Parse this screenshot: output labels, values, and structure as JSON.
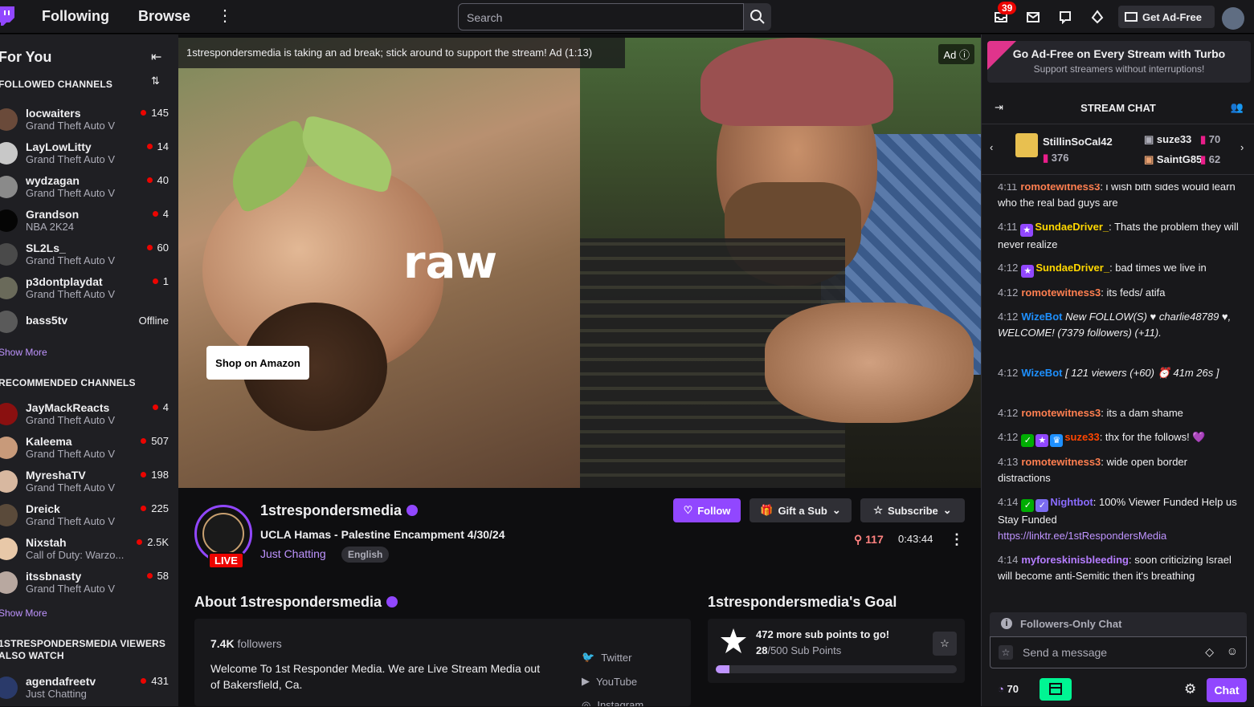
{
  "topbar": {
    "following": "Following",
    "browse": "Browse",
    "search_placeholder": "Search",
    "notif_count": "39",
    "get_ad_free": "Get Ad-Free"
  },
  "sidebar": {
    "title": "For You",
    "followed_header": "Followed Channels",
    "followed": [
      {
        "name": "locwaiters",
        "game": "Grand Theft Auto V",
        "viewers": "145"
      },
      {
        "name": "LayLowLitty",
        "game": "Grand Theft Auto V",
        "viewers": "14"
      },
      {
        "name": "wydzagan",
        "game": "Grand Theft Auto V",
        "viewers": "40"
      },
      {
        "name": "Grandson",
        "game": "NBA 2K24",
        "viewers": "4"
      },
      {
        "name": "SL2Ls_",
        "game": "Grand Theft Auto V",
        "viewers": "60"
      },
      {
        "name": "p3dontplaydat",
        "game": "Grand Theft Auto V",
        "viewers": "1"
      },
      {
        "name": "bass5tv",
        "status": "Offline"
      }
    ],
    "show_more": "Show More",
    "recommended_header": "Recommended Channels",
    "recommended": [
      {
        "name": "JayMackReacts",
        "game": "Grand Theft Auto V",
        "viewers": "4"
      },
      {
        "name": "Kaleema",
        "game": "Grand Theft Auto V",
        "viewers": "507"
      },
      {
        "name": "MyreshaTV",
        "game": "Grand Theft Auto V",
        "viewers": "198"
      },
      {
        "name": "Dreick",
        "game": "Grand Theft Auto V",
        "viewers": "225"
      },
      {
        "name": "Nixstah",
        "game": "Call of Duty: Warzo...",
        "viewers": "2.5K"
      },
      {
        "name": "itssbnasty",
        "game": "Grand Theft Auto V",
        "viewers": "58"
      }
    ],
    "show_more_2": "Show More",
    "also_watch_header_1": "1stRespondersMedia Viewers",
    "also_watch_header_2": "Also Watch",
    "also_watch": [
      {
        "name": "agendafreetv",
        "game": "Just Chatting",
        "viewers": "431"
      }
    ]
  },
  "player": {
    "ad_message": "1strespondersmedia is taking an ad break; stick around to support the stream! Ad (1:13)",
    "ad_label": "Ad",
    "overlay_text": "raw",
    "shop_button": "Shop on Amazon"
  },
  "channel": {
    "name": "1strespondersmedia",
    "live": "LIVE",
    "title": "UCLA Hamas - Palestine Encampment 4/30/24",
    "category": "Just Chatting",
    "language": "English",
    "follow": "Follow",
    "gift": "Gift a Sub",
    "subscribe": "Subscribe",
    "viewers": "117",
    "uptime": "0:43:44",
    "about_title": "About 1strespondersmedia",
    "followers_count": "7.4K",
    "followers_label": "followers",
    "description": "Welcome To 1st Responder Media. We are Live Stream Media out of Bakersfield, Ca.",
    "social": [
      "Twitter",
      "YouTube",
      "Instagram"
    ],
    "goal_title": "1strespondersmedia's Goal",
    "goal_main": "472 more sub points to go!",
    "goal_current": "28",
    "goal_total": "/500 Sub Points",
    "goal_progress": 0.056
  },
  "chat": {
    "turbo_title": "Go Ad-Free on Every Stream with Turbo",
    "turbo_sub": "Support streamers without interruptions!",
    "header": "STREAM CHAT",
    "leaders": [
      {
        "name": "StillinSoCal42",
        "value": "376"
      },
      {
        "name": "suze33",
        "value": "70"
      },
      {
        "name": "SaintG85",
        "value": "62"
      }
    ],
    "messages": [
      {
        "ts": "4:11",
        "user": "romotewitness3",
        "color": "#ff7f50",
        "text": ": i wish bith sides would learn who the real bad guys are"
      },
      {
        "ts": "4:11",
        "user": "SundaeDriver_",
        "color": "#ffd700",
        "text": ": Thats the problem they will never realize"
      },
      {
        "ts": "4:12",
        "user": "SundaeDriver_",
        "color": "#ffd700",
        "text": ": bad times we live in"
      },
      {
        "ts": "4:12",
        "user": "romotewitness3",
        "color": "#ff7f50",
        "text": ": its feds/ atifa"
      },
      {
        "ts": "4:12",
        "user": "WizeBot",
        "color": "#1e90ff",
        "text": " New FOLLOW(S) ♥ charlie48789 ♥, WELCOME! (7379 followers) (+11)."
      },
      {
        "ts": "4:12",
        "user": "WizeBot",
        "color": "#1e90ff",
        "text": " [ 121 viewers (+60) ⏰ 41m 26s ]"
      },
      {
        "ts": "4:12",
        "user": "romotewitness3",
        "color": "#ff7f50",
        "text": ": its a dam shame"
      },
      {
        "ts": "4:12",
        "user": "suze33",
        "color": "#ff4500",
        "text": ": thx for the follows! 💜"
      },
      {
        "ts": "4:13",
        "user": "romotewitness3",
        "color": "#ff7f50",
        "text": ": wide open border distractions"
      },
      {
        "ts": "4:14",
        "user": "Nightbot",
        "color": "#8a6cff",
        "text": ": 100% Viewer Funded Help us Stay Funded"
      },
      {
        "ts": "4:14",
        "user": "myforeskinisbleeding",
        "color": "#b57dff",
        "text": ": soon criticizing Israel will become anti-Semitic then it's breathing"
      }
    ],
    "nightbot_link": "https://linktr.ee/1stRespondersMedia",
    "followers_only": "Followers-Only Chat",
    "input_placeholder": "Send a message",
    "points": "70",
    "chat_button": "Chat"
  }
}
